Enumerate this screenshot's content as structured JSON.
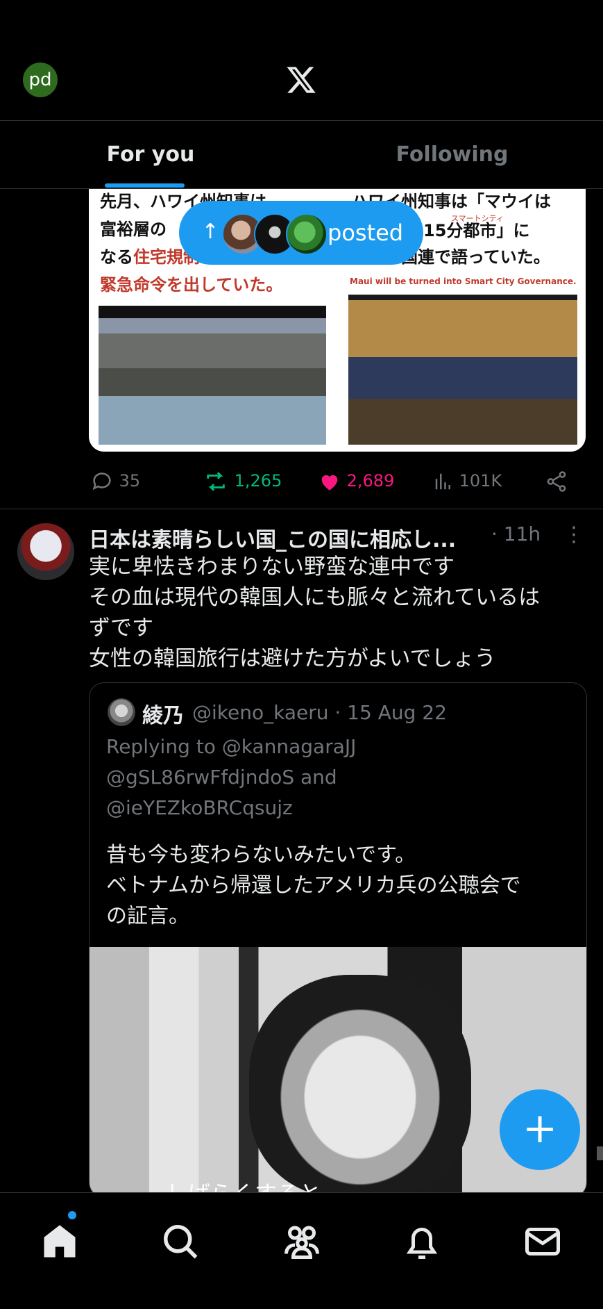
{
  "header": {
    "avatar_initials": "pd",
    "logo": "x-logo-icon"
  },
  "tabs": [
    {
      "label": "For you",
      "active": true
    },
    {
      "label": "Following",
      "active": false
    }
  ],
  "new_posts_pill": {
    "label": "posted"
  },
  "tweet1": {
    "media_left": {
      "lines": [
        "先月、ハワイ州知事は",
        "富裕層の",
        "なる",
        "住宅規制",
        "緊急命令を出していた。"
      ]
    },
    "media_right": {
      "lines": [
        "ハワイ州知事は「マウイは",
        "15分都市」に",
        "なると国連で語っていた。"
      ],
      "ruby": "スマートシティ",
      "caption": "Maui will be turned into Smart City Governance."
    },
    "actions": {
      "replies": "35",
      "reposts": "1,265",
      "likes": "2,689",
      "views": "101K"
    }
  },
  "tweet2": {
    "name": "日本は素晴らしい国_この国に相応し...",
    "time": "· 11h",
    "body_lines": [
      "実に卑怯きわまりない野蛮な連中です",
      "その血は現代の韓国人にも脈々と流れているは",
      "ずです",
      "女性の韓国旅行は避けた方がよいでしょう"
    ],
    "quote": {
      "name": "綾乃",
      "meta": "@ikeno_kaeru · 15 Aug 22",
      "replying_lines": [
        "Replying to @kannagaraJJ",
        "@gSL86rwFfdjndoS and",
        "@ieYEZkoBRCqsujz"
      ],
      "body_lines": [
        "昔も今も変わらないみたいです。",
        "ベトナムから帰還したアメリカ兵の公聴会で",
        "の証言。"
      ],
      "video_subtitle": "しばらくすると"
    }
  },
  "fab": {
    "label": "+"
  },
  "bottom_nav": [
    "home-icon",
    "search-icon",
    "communities-icon",
    "notifications-icon",
    "messages-icon"
  ],
  "colors": {
    "accent": "#1d9bf0",
    "repost": "#00ba7c",
    "like": "#f91880",
    "muted": "#71767b"
  }
}
